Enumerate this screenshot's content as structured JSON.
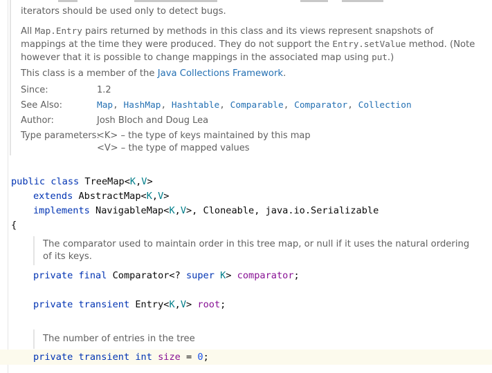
{
  "doc": {
    "line0": "iterators should be used only to detect bugs.",
    "para1": {
      "t1": "All ",
      "c1": "Map.Entry",
      "t2": " pairs returned by methods in this class and its views represent snapshots of mappings at the time they were produced. They do not support the ",
      "c2": "Entry.setValue",
      "t3": " method. (Note however that it is possible to change mappings in the associated map using ",
      "c3": "put",
      "t4": ".)"
    },
    "member": {
      "prefix": "This class is a member of the ",
      "link": "Java Collections Framework",
      "suffix": "."
    },
    "since": {
      "label": "Since:",
      "value": "1.2"
    },
    "see_also": {
      "label": "See Also:",
      "links": [
        "Map",
        "HashMap",
        "Hashtable",
        "Comparable",
        "Comparator",
        "Collection"
      ]
    },
    "author": {
      "label": "Author:",
      "value": "Josh Bloch and Doug Lea"
    },
    "type_params": {
      "label": "Type parameters:",
      "k": "<K> – the type of keys maintained by this map",
      "v": "<V> – the type of mapped values"
    }
  },
  "code": {
    "decl": {
      "public": "public",
      "class": "class",
      "name": "TreeMap<",
      "K": "K",
      "comma": ",",
      "V": "V",
      "close": ">"
    },
    "extends": {
      "kw": "extends",
      "name": "AbstractMap<",
      "K": "K",
      "comma": ",",
      "V": "V",
      "close": ">"
    },
    "implements": {
      "kw": "implements",
      "name": "NavigableMap<",
      "K": "K",
      "comma": ",",
      "V": "V",
      "rest": ">, Cloneable, java.io.Serializable"
    },
    "brace": "{",
    "comment1": "The comparator used to maintain order in this tree map, or null if it uses the natural ordering of its keys.",
    "field1": {
      "private": "private",
      "final": "final",
      "type": "Comparator<? ",
      "super": "super",
      "K": "K",
      "gt": "> ",
      "name": "comparator",
      "semi": ";"
    },
    "field2": {
      "private": "private",
      "transient": "transient",
      "type": "Entry<",
      "K": "K",
      "comma": ",",
      "V": "V",
      "gt": "> ",
      "name": "root",
      "semi": ";"
    },
    "comment2": "The number of entries in the tree",
    "field3": {
      "private": "private",
      "transient": "transient",
      "int": "int",
      "name": "size",
      "eq": " = ",
      "val": "0",
      "semi": ";"
    }
  }
}
